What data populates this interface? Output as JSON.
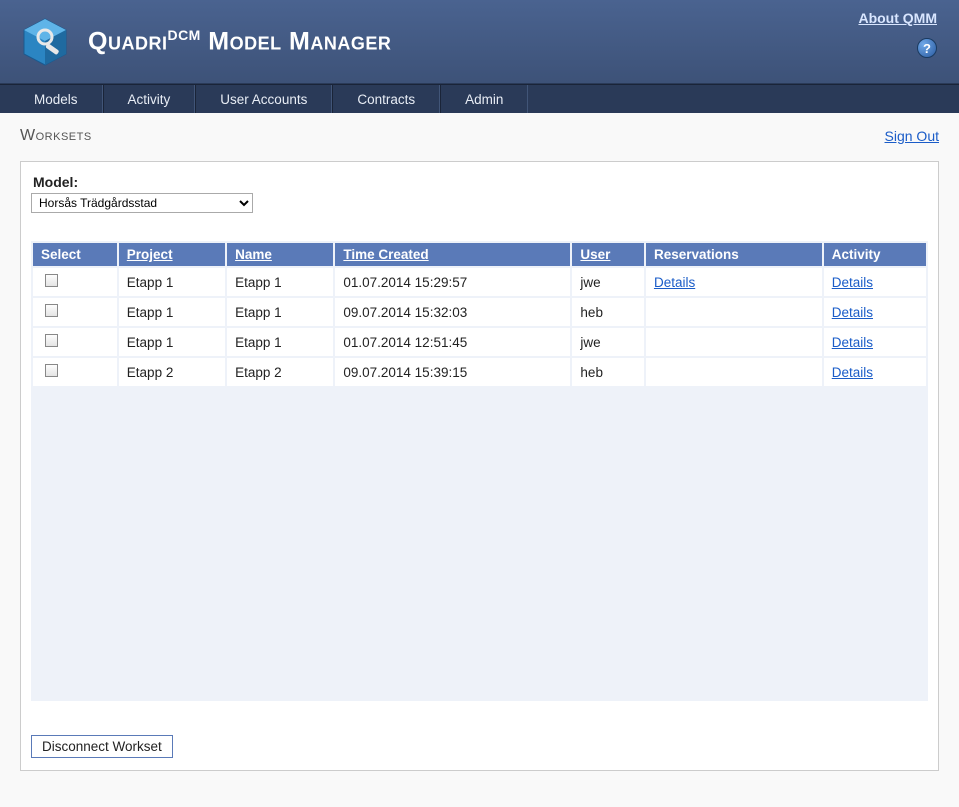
{
  "header": {
    "title_prefix": "Quadri",
    "title_sup": "DCM",
    "title_suffix": " Model Manager",
    "about_label": "About QMM",
    "help_glyph": "?"
  },
  "nav": {
    "items": [
      "Models",
      "Activity",
      "User Accounts",
      "Contracts",
      "Admin"
    ]
  },
  "page": {
    "title": "Worksets",
    "signout": "Sign Out"
  },
  "model_picker": {
    "label": "Model:",
    "selected": "Horsås Trädgårdsstad"
  },
  "table": {
    "headers": {
      "select": "Select",
      "project": "Project",
      "name": "Name",
      "time": "Time Created",
      "user": "User",
      "reservations": "Reservations",
      "activity": "Activity"
    },
    "details_label": "Details",
    "rows": [
      {
        "project": "Etapp 1",
        "name": "Etapp 1",
        "time": "01.07.2014 15:29:57",
        "user": "jwe",
        "has_reservation": true
      },
      {
        "project": "Etapp 1",
        "name": "Etapp 1",
        "time": "09.07.2014 15:32:03",
        "user": "heb",
        "has_reservation": false
      },
      {
        "project": "Etapp 1",
        "name": "Etapp 1",
        "time": "01.07.2014 12:51:45",
        "user": "jwe",
        "has_reservation": false
      },
      {
        "project": "Etapp 2",
        "name": "Etapp 2",
        "time": "09.07.2014 15:39:15",
        "user": "heb",
        "has_reservation": false
      }
    ]
  },
  "buttons": {
    "disconnect": "Disconnect Workset"
  }
}
